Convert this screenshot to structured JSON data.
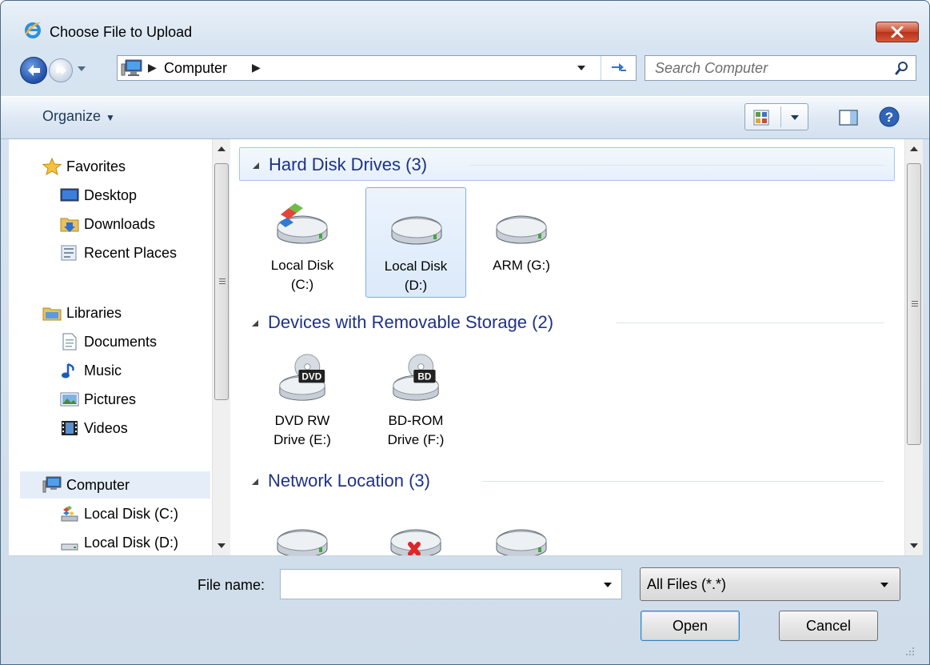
{
  "window": {
    "title": "Choose File to Upload"
  },
  "address": {
    "location": "Computer"
  },
  "search": {
    "placeholder": "Search Computer"
  },
  "toolbar": {
    "organize_label": "Organize"
  },
  "nav": {
    "items": [
      {
        "label": "Favorites",
        "icon": "star-icon"
      },
      {
        "label": "Desktop",
        "icon": "desktop-icon"
      },
      {
        "label": "Downloads",
        "icon": "downloads-folder-icon"
      },
      {
        "label": "Recent Places",
        "icon": "recent-places-icon"
      },
      {
        "label": "Libraries",
        "icon": "libraries-icon"
      },
      {
        "label": "Documents",
        "icon": "documents-icon"
      },
      {
        "label": "Music",
        "icon": "music-icon"
      },
      {
        "label": "Pictures",
        "icon": "pictures-icon"
      },
      {
        "label": "Videos",
        "icon": "videos-icon"
      },
      {
        "label": "Computer",
        "icon": "computer-icon"
      },
      {
        "label": "Local Disk (C:)",
        "icon": "system-drive-icon"
      },
      {
        "label": "Local Disk (D:)",
        "icon": "drive-icon"
      }
    ]
  },
  "groups": [
    {
      "title": "Hard Disk Drives (3)",
      "items": [
        {
          "line1": "Local Disk",
          "line2": "(C:)",
          "icon": "system-drive-icon"
        },
        {
          "line1": "Local Disk",
          "line2": "(D:)",
          "icon": "drive-icon"
        },
        {
          "line1": "ARM (G:)",
          "line2": "",
          "icon": "drive-icon"
        }
      ]
    },
    {
      "title": "Devices with Removable Storage (2)",
      "items": [
        {
          "line1": "DVD RW",
          "line2": "Drive (E:)",
          "icon": "dvd-drive-icon",
          "badge": "DVD"
        },
        {
          "line1": "BD-ROM",
          "line2": "Drive (F:)",
          "icon": "bd-drive-icon",
          "badge": "BD"
        }
      ]
    },
    {
      "title": "Network Location (3)",
      "items": [
        {
          "icon": "network-drive-icon"
        },
        {
          "icon": "network-drive-disconnected-icon"
        },
        {
          "icon": "network-drive-icon"
        }
      ]
    }
  ],
  "bottom": {
    "filename_label": "File name:",
    "filename_value": "",
    "filetype_value": "All Files (*.*)",
    "open_label": "Open",
    "cancel_label": "Cancel"
  }
}
